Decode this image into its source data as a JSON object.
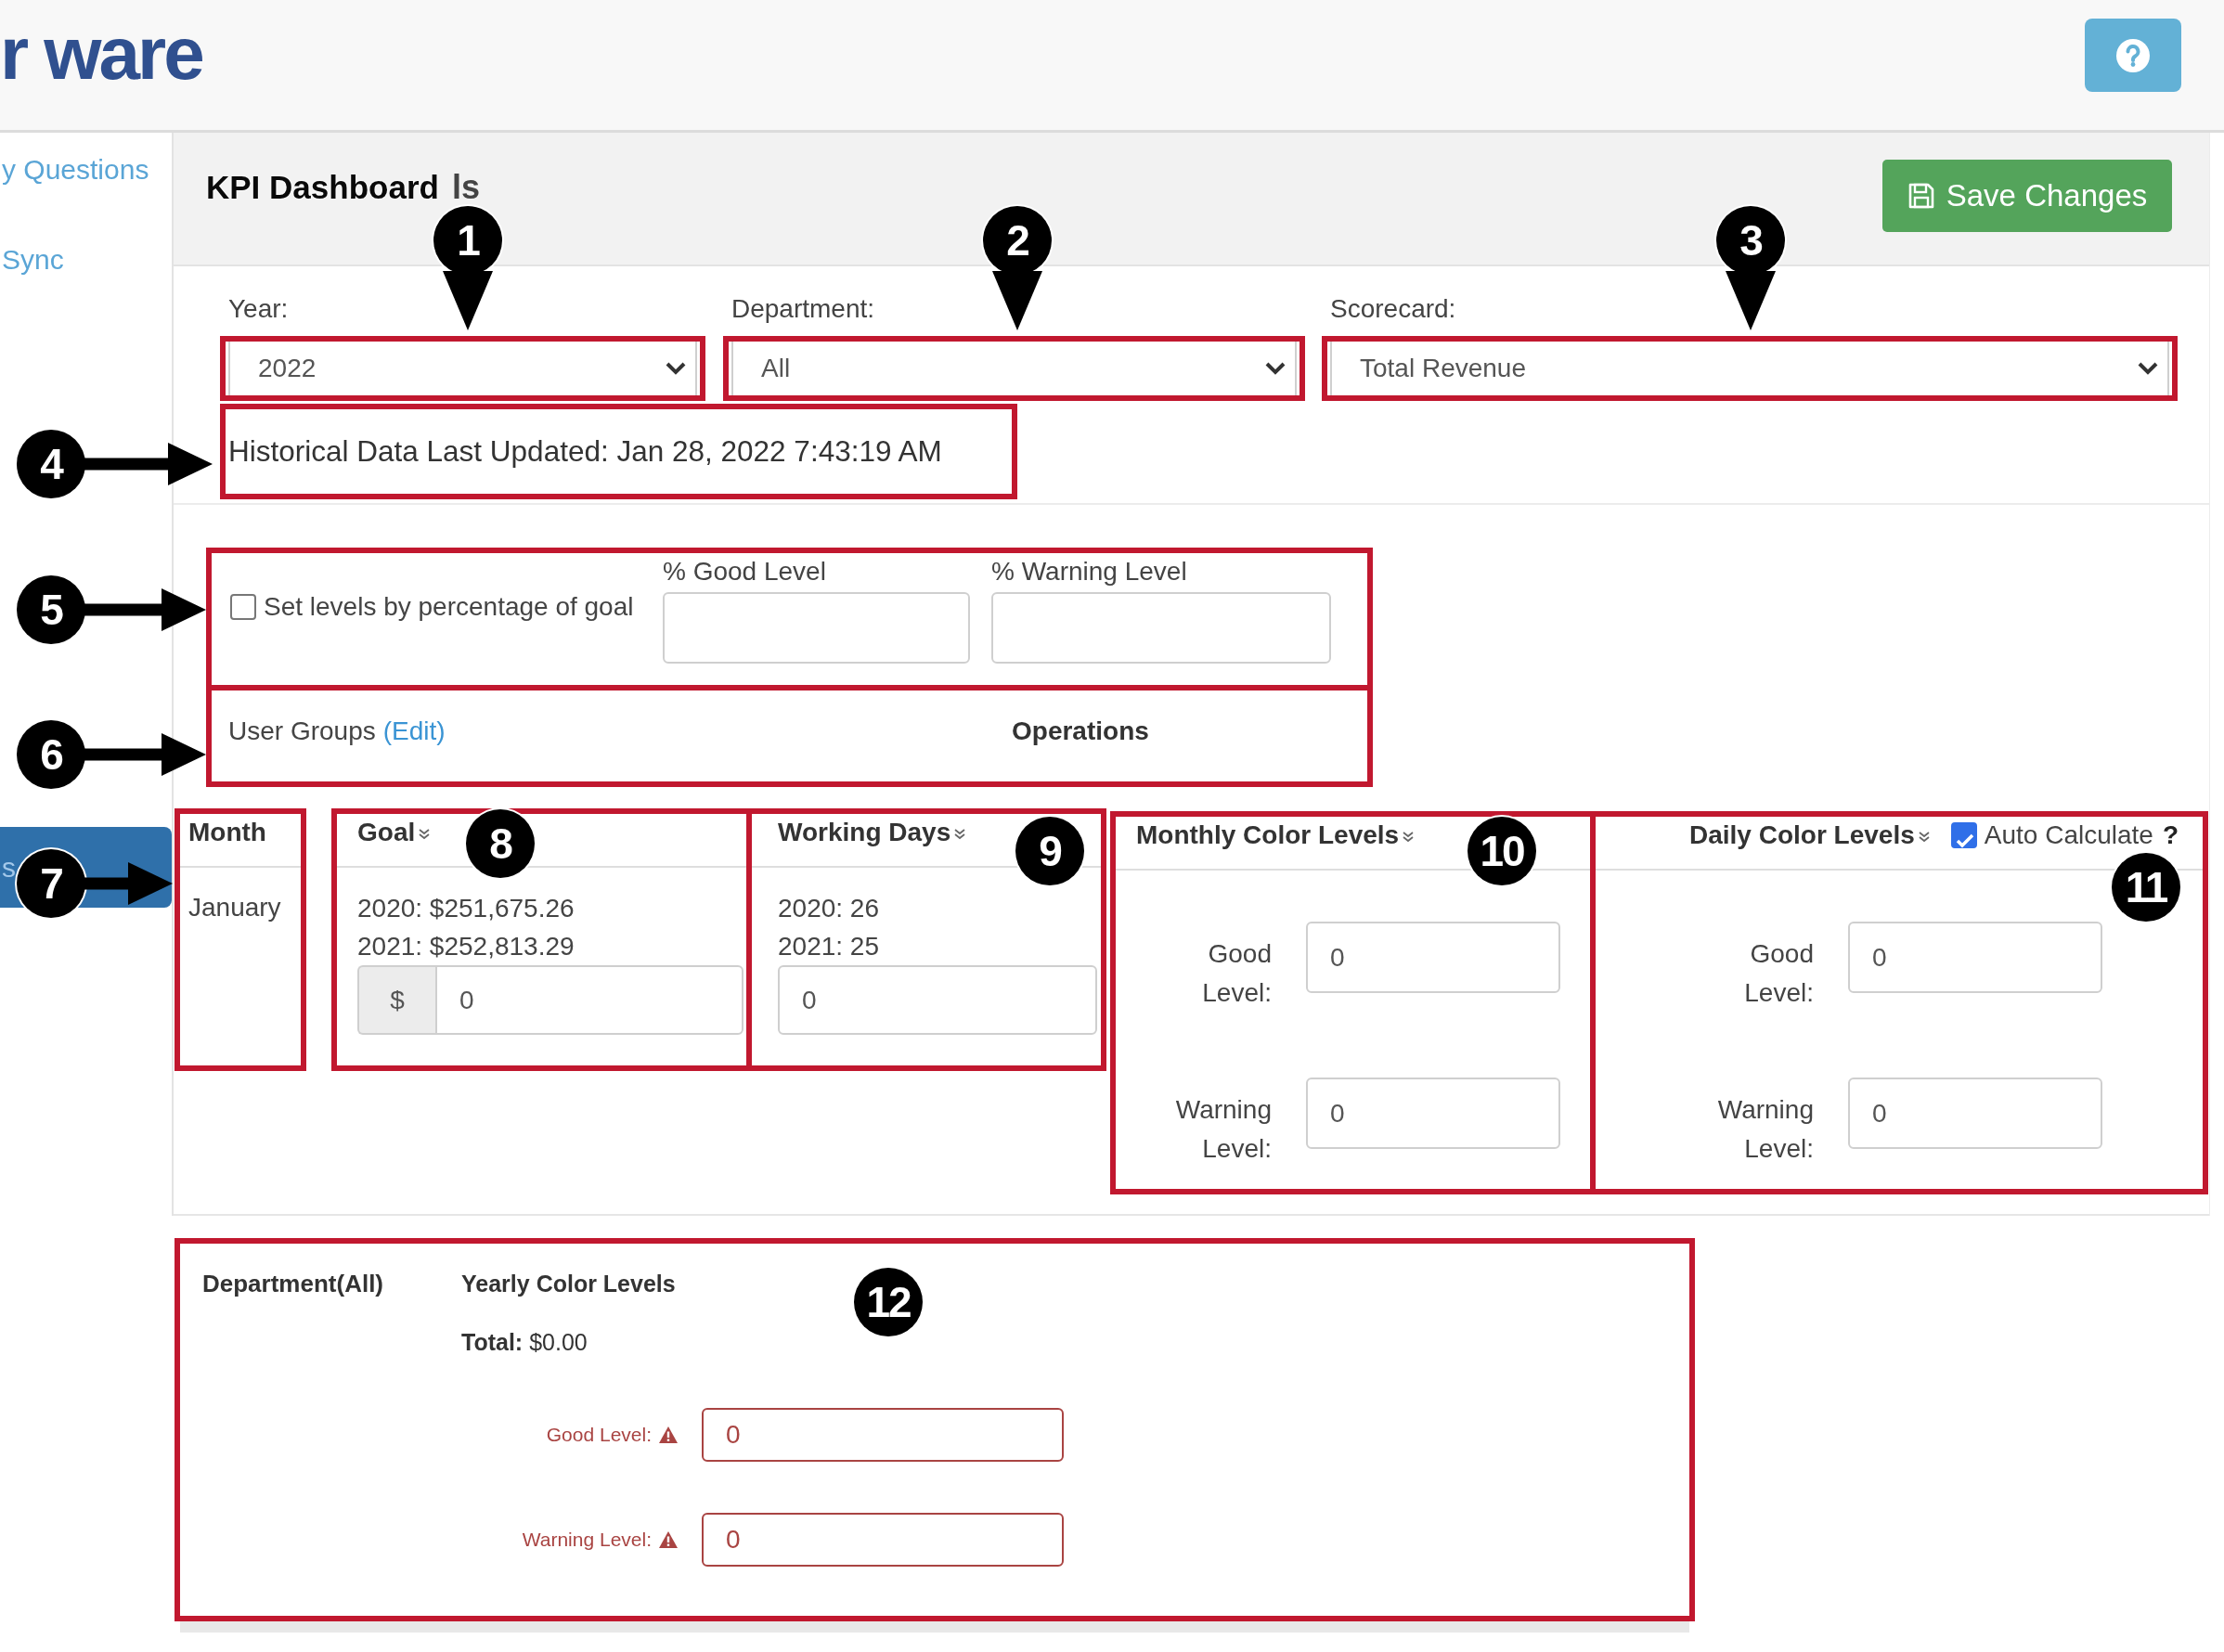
{
  "header": {
    "logo": "r ware"
  },
  "sidebar": {
    "items": [
      {
        "label": "y Questions",
        "selected": false
      },
      {
        "label": "Sync",
        "selected": false
      },
      {
        "label": "s",
        "selected": true
      }
    ]
  },
  "toolbar": {
    "title": "KPI Dashboard",
    "title_remnant": "ls",
    "save_button": "Save Changes"
  },
  "filters": [
    {
      "label": "Year:",
      "value": "2022"
    },
    {
      "label": "Department:",
      "value": "All"
    },
    {
      "label": "Scorecard:",
      "value": "Total Revenue"
    }
  ],
  "last_updated": "Historical Data Last Updated: Jan 28, 2022 7:43:19 AM",
  "percentage_levels": {
    "checkbox": {
      "label": "Set levels by percentage of goal",
      "checked": false
    },
    "fields": [
      {
        "label": "% Good Level"
      },
      {
        "label": "% Warning Level"
      }
    ]
  },
  "user_groups": {
    "label": "User Groups",
    "link": "(Edit)",
    "value": "Operations"
  },
  "table": {
    "columns": [
      {
        "header": "Month",
        "toggle": false
      },
      {
        "header": "Goal",
        "toggle": true
      },
      {
        "header": "Working Days",
        "toggle": true
      },
      {
        "header": "Monthly Color Levels",
        "toggle": true
      },
      {
        "header": "Daily Color Levels",
        "toggle": true
      }
    ],
    "auto_calculate": {
      "label": "Auto Calculate",
      "checked": true,
      "help": "?"
    },
    "row": {
      "month": "January",
      "goal": {
        "history": [
          "2020: $251,675.26",
          "2021: $252,813.29"
        ],
        "prefix": "$",
        "value": "0"
      },
      "working_days": {
        "history": [
          "2020: 26",
          "2021: 25"
        ],
        "value": "0"
      },
      "monthly_levels": [
        {
          "label": "Good Level:",
          "value": "0"
        },
        {
          "label": "Warning Level:",
          "value": "0"
        }
      ],
      "daily_levels": [
        {
          "label": "Good Level:",
          "value": "0"
        },
        {
          "label": "Warning Level:",
          "value": "0"
        }
      ]
    }
  },
  "yearly": {
    "department": "Department(All)",
    "heading": "Yearly Color Levels",
    "total": "**Total:** $0.00",
    "fields": [
      {
        "label": "Good Level:",
        "value": "0",
        "warning": true
      },
      {
        "label": "Warning Level:",
        "value": "0",
        "warning": true
      }
    ]
  },
  "annotations": [
    {
      "number": "1",
      "kind": "down"
    },
    {
      "number": "2",
      "kind": "down"
    },
    {
      "number": "3",
      "kind": "down"
    },
    {
      "number": "4",
      "kind": "right"
    },
    {
      "number": "5",
      "kind": "right"
    },
    {
      "number": "6",
      "kind": "right"
    },
    {
      "number": "7",
      "kind": "right"
    },
    {
      "number": "8",
      "kind": "plain"
    },
    {
      "number": "9",
      "kind": "plain"
    },
    {
      "number": "10",
      "kind": "plain"
    },
    {
      "number": "11",
      "kind": "plain"
    },
    {
      "number": "12",
      "kind": "plain"
    }
  ]
}
